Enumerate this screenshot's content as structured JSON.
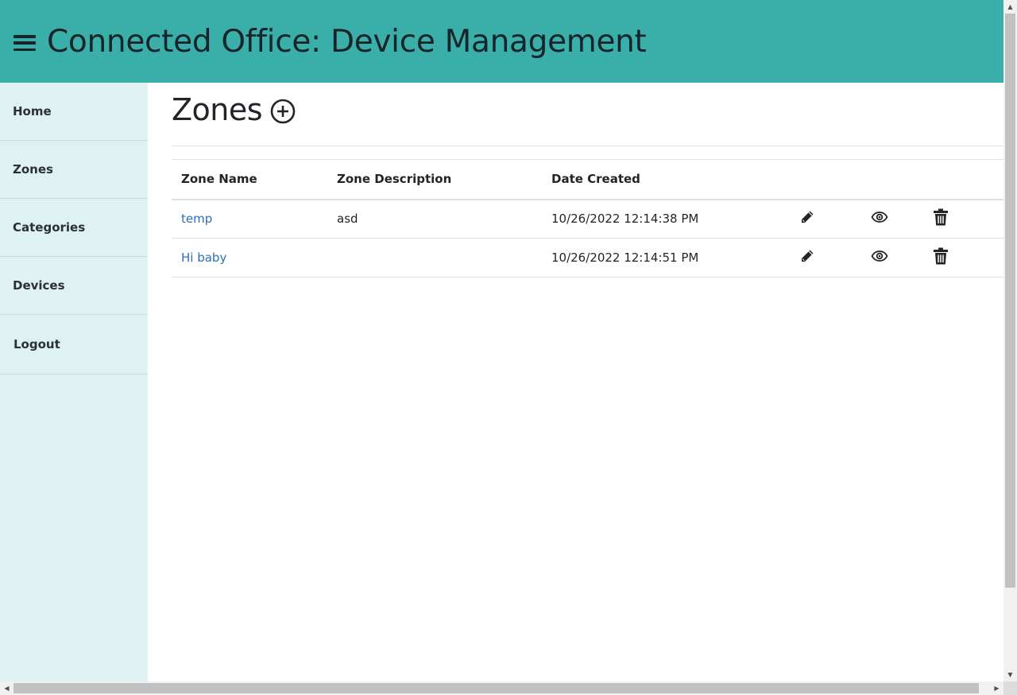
{
  "header": {
    "title": "Connected Office: Device Management",
    "menu_icon": "hamburger-menu-icon",
    "bg_color": "#3aafa9"
  },
  "sidebar": {
    "bg_color": "#def2f1",
    "items": [
      {
        "label": "Home"
      },
      {
        "label": "Zones"
      },
      {
        "label": "Categories"
      },
      {
        "label": "Devices"
      },
      {
        "label": "Logout"
      }
    ]
  },
  "main": {
    "title": "Zones",
    "add_icon": "plus-circle-icon",
    "table": {
      "columns": [
        "Zone Name",
        "Zone Description",
        "Date Created"
      ],
      "rows": [
        {
          "name": "temp",
          "description": "asd",
          "created": "10/26/2022 12:14:38 PM"
        },
        {
          "name": "Hi baby",
          "description": "",
          "created": "10/26/2022 12:14:51 PM"
        }
      ],
      "actions": [
        "pencil-edit-icon",
        "eye-view-icon",
        "trash-delete-icon"
      ],
      "link_color": "#2a6fbd"
    }
  }
}
